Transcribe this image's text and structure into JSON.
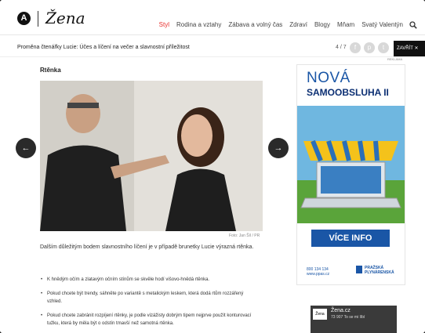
{
  "header": {
    "logo_letter": "A",
    "logo_text": "Žena",
    "nav": [
      "Styl",
      "Rodina a vztahy",
      "Zábava a volný čas",
      "Zdraví",
      "Blogy",
      "Mňam",
      "Svatý Valentýn"
    ],
    "active_nav": "Styl",
    "search_icon": "search-icon"
  },
  "article_bar": {
    "title": "Proměna čtenářky Lucie: Účes a líčení na večer a slavnostní příležitost",
    "counter": "4 / 7",
    "close_label": "ZAVŘÍT",
    "ad_label": "REKLAMA"
  },
  "content": {
    "section_title": "Rtěnka",
    "photo_credit": "Foto: Jan Šíl / PR",
    "paragraph": "Dalším důležitým bodem slavnostního líčení je v případě brunetky Lucie výrazná rtěnka.",
    "bullets": [
      "K hnědým očím a zlatavým očním stínům se skvěle hodí višovo-hnědá rtěnka.",
      "Pokud chcete být trendy, sáhněte po variantě s metalickým leskem, která dodá rtům rozzářený vzhled.",
      "Pokud chcete zabránit rozpíjení rtěnky, je podle vizážisty dobrým tipem nejprve použít konturovací tužku, která by měla být o odstín tmavší než samotná rtěnka."
    ]
  },
  "ad": {
    "line1": "NOVÁ",
    "line2": "SAMOOBSLUHA II",
    "button": "VÍCE INFO",
    "phone": "800 134 134",
    "web": "www.ppas.cz",
    "brand1": "PRAŽSKÁ",
    "brand2": "PLYNÁRENSKÁ"
  },
  "fb_widget": {
    "name": "Žena.cz",
    "sub": "73 907 To se mi líbí"
  }
}
